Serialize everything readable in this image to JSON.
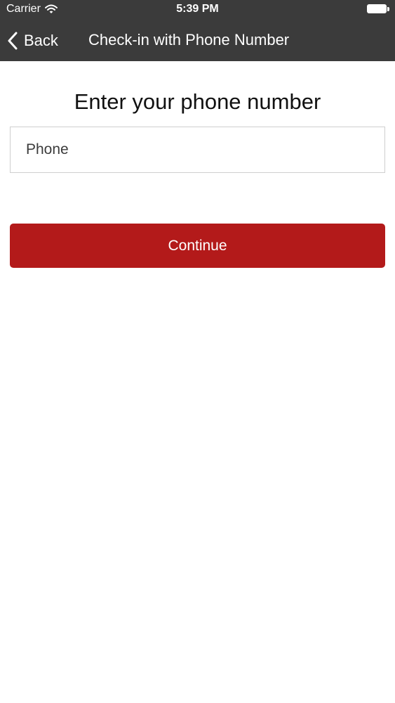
{
  "status_bar": {
    "carrier": "Carrier",
    "time": "5:39 PM",
    "wifi_icon": "wifi-icon",
    "battery_icon": "battery-icon"
  },
  "nav_bar": {
    "back_label": "Back",
    "back_icon": "chevron-left-icon",
    "title": "Check-in with Phone Number",
    "background_color": "#3b3b3b"
  },
  "form": {
    "heading": "Enter your phone number",
    "phone_input": {
      "value": "",
      "placeholder": "Phone"
    },
    "continue_label": "Continue",
    "continue_color": "#b31a1a"
  }
}
